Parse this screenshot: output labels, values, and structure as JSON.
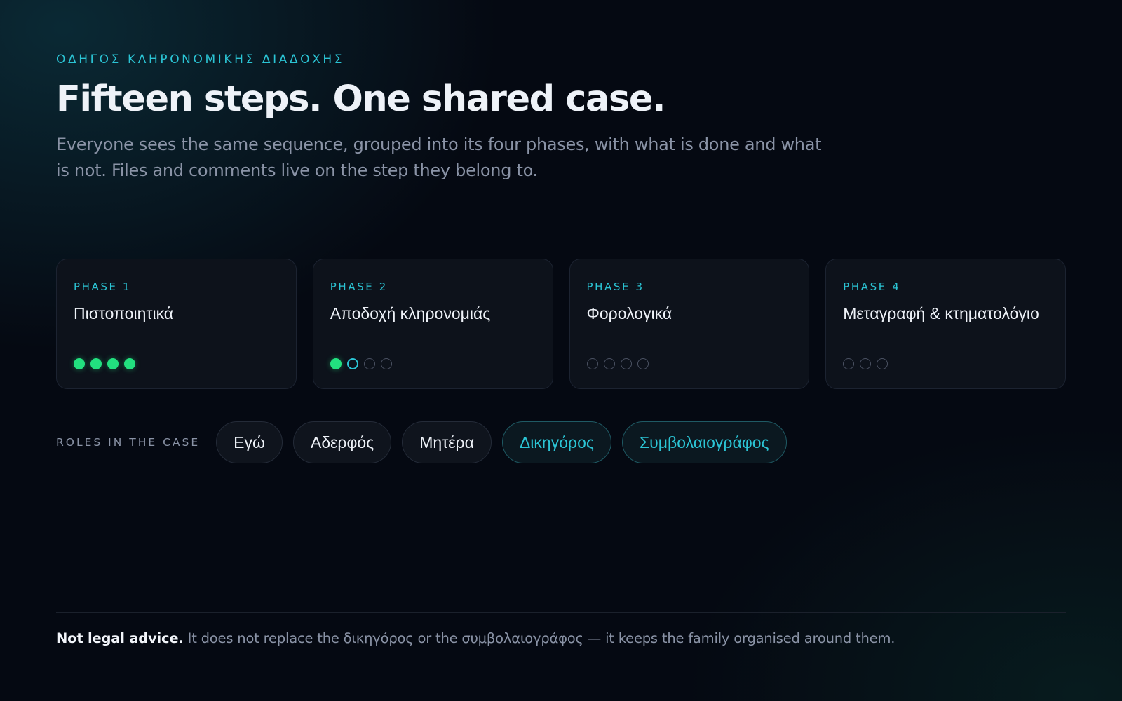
{
  "header": {
    "eyebrow": "ΟΔΗΓΟΣ ΚΛΗΡΟΝΟΜΙΚΗΣ ΔΙΑΔΟΧΗΣ",
    "title": "Fifteen steps. One shared case.",
    "subtitle": "Everyone sees the same sequence, grouped into its four phases, with what is done and what is not. Files and comments live on the step they belong to."
  },
  "phases": [
    {
      "label": "PHASE 1",
      "name": "Πιστοποιητικά",
      "steps_total": 4,
      "steps_done": 4,
      "current_step": null
    },
    {
      "label": "PHASE 2",
      "name": "Αποδοχή κληρονομιάς",
      "steps_total": 4,
      "steps_done": 1,
      "current_step": 2
    },
    {
      "label": "PHASE 3",
      "name": "Φορολογικά",
      "steps_total": 4,
      "steps_done": 0,
      "current_step": null
    },
    {
      "label": "PHASE 4",
      "name": "Μεταγραφή & κτηματολόγιο",
      "steps_total": 3,
      "steps_done": 0,
      "current_step": null
    }
  ],
  "roles": {
    "label": "ROLES IN THE CASE",
    "items": [
      {
        "label": "Εγώ",
        "professional": false
      },
      {
        "label": "Αδερφός",
        "professional": false
      },
      {
        "label": "Μητέρα",
        "professional": false
      },
      {
        "label": "Δικηγόρος",
        "professional": true
      },
      {
        "label": "Συμβολαιογράφος",
        "professional": true
      }
    ]
  },
  "footer": {
    "bold": "Not legal advice.",
    "text": " It does not replace the δικηγόρος or the συμβολαιογράφος — it keeps the family organised around them."
  },
  "colors": {
    "accent": "#2bc4d4",
    "done": "#22e07f",
    "background": "#050912",
    "card": "#0d121b"
  }
}
